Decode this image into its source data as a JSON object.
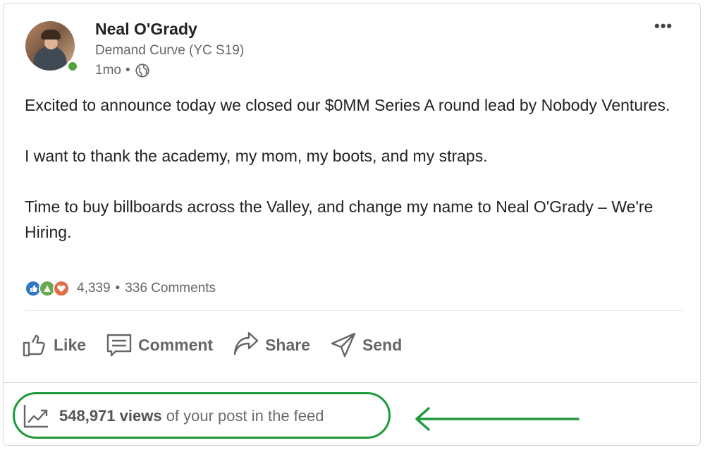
{
  "post": {
    "author_name": "Neal O'Grady",
    "author_headline": "Demand Curve (YC S19)",
    "time": "1mo",
    "separator": "•",
    "more_icon": "more-horizontal-icon",
    "text": {
      "p1": "Excited to announce today we closed our $0MM Series A round lead by Nobody Ventures.",
      "p2": "I want to thank the academy, my mom, my boots, and my straps.",
      "p3": "Time to buy billboards across the Valley, and change my name to Neal O'Grady – We're Hiring."
    },
    "social": {
      "reactions_count": "4,339",
      "dot": "•",
      "comments": "336 Comments"
    },
    "actions": {
      "like": "Like",
      "comment": "Comment",
      "share": "Share",
      "send": "Send"
    },
    "analytics": {
      "views_count": "548,971 views",
      "views_suffix": " of your post in the feed"
    }
  },
  "colors": {
    "highlight": "#1e9a3a",
    "presence": "#52a33a",
    "like": "#2f78c4",
    "celebrate": "#6aa84f",
    "love": "#e06d47"
  }
}
